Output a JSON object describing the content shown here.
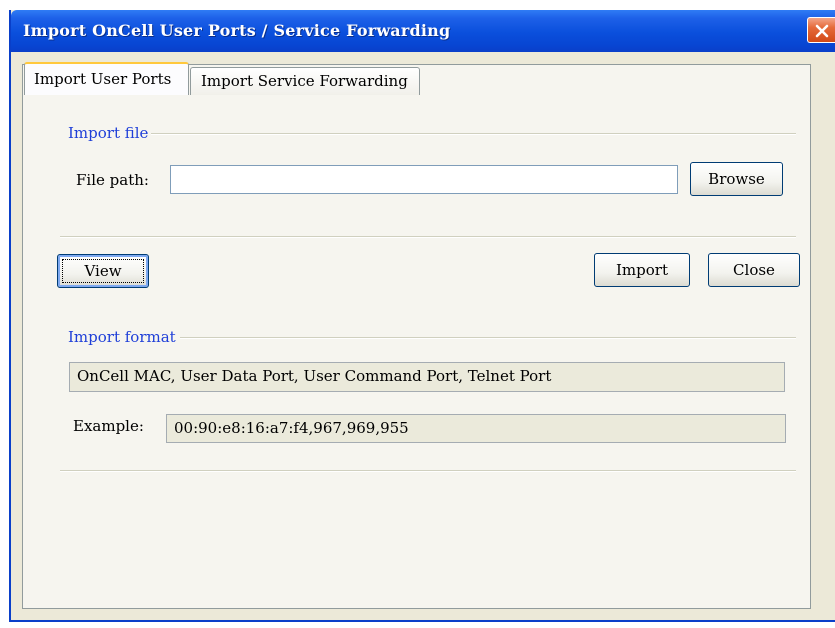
{
  "window": {
    "title": "Import OnCell User Ports / Service Forwarding"
  },
  "tabs": [
    {
      "label": "Import User Ports",
      "active": true
    },
    {
      "label": "Import Service Forwarding",
      "active": false
    }
  ],
  "import_file": {
    "section_label": "Import file",
    "file_path_label": "File path:",
    "file_path_value": "",
    "browse_label": "Browse"
  },
  "actions": {
    "view_label": "View",
    "import_label": "Import",
    "close_label": "Close"
  },
  "import_format": {
    "section_label": "Import format",
    "format_text": "OnCell MAC, User Data Port, User Command Port, Telnet Port",
    "example_label": "Example:",
    "example_value": "00:90:e8:16:a7:f4,967,969,955"
  },
  "icons": {
    "close": "close-icon"
  },
  "colors": {
    "titlebar": "#0a4fdc",
    "section_label": "#1f3fd8",
    "close_button": "#d24a18",
    "active_tab_accent": "#ffc83c"
  }
}
